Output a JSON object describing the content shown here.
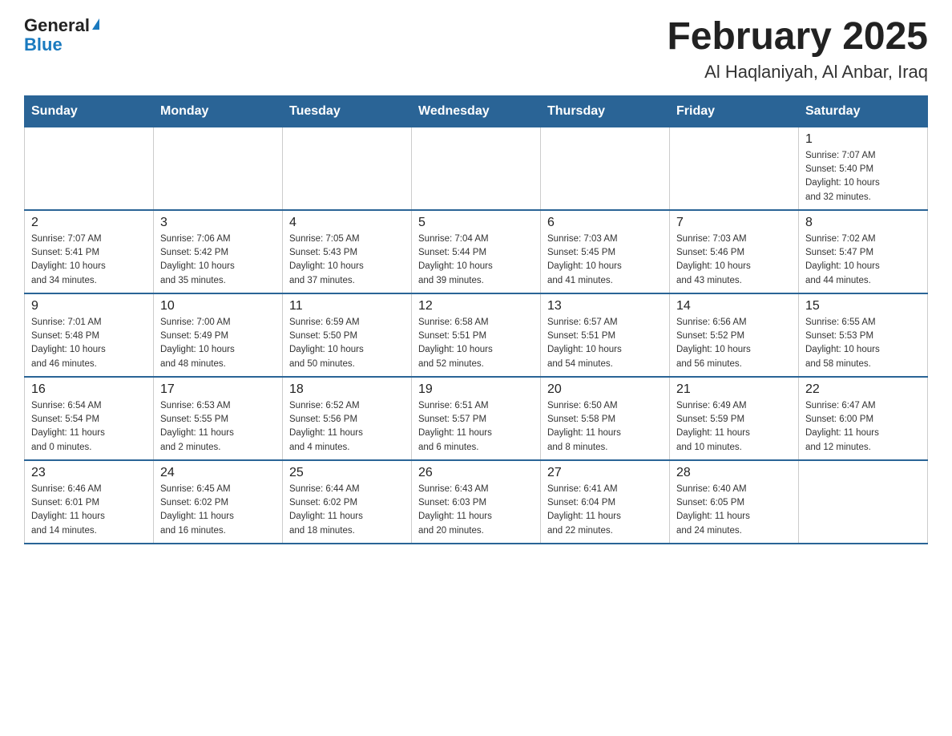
{
  "header": {
    "logo_general": "General",
    "logo_blue": "Blue",
    "month_title": "February 2025",
    "location": "Al Haqlaniyah, Al Anbar, Iraq"
  },
  "days_of_week": [
    "Sunday",
    "Monday",
    "Tuesday",
    "Wednesday",
    "Thursday",
    "Friday",
    "Saturday"
  ],
  "weeks": [
    [
      {
        "day": "",
        "info": ""
      },
      {
        "day": "",
        "info": ""
      },
      {
        "day": "",
        "info": ""
      },
      {
        "day": "",
        "info": ""
      },
      {
        "day": "",
        "info": ""
      },
      {
        "day": "",
        "info": ""
      },
      {
        "day": "1",
        "info": "Sunrise: 7:07 AM\nSunset: 5:40 PM\nDaylight: 10 hours\nand 32 minutes."
      }
    ],
    [
      {
        "day": "2",
        "info": "Sunrise: 7:07 AM\nSunset: 5:41 PM\nDaylight: 10 hours\nand 34 minutes."
      },
      {
        "day": "3",
        "info": "Sunrise: 7:06 AM\nSunset: 5:42 PM\nDaylight: 10 hours\nand 35 minutes."
      },
      {
        "day": "4",
        "info": "Sunrise: 7:05 AM\nSunset: 5:43 PM\nDaylight: 10 hours\nand 37 minutes."
      },
      {
        "day": "5",
        "info": "Sunrise: 7:04 AM\nSunset: 5:44 PM\nDaylight: 10 hours\nand 39 minutes."
      },
      {
        "day": "6",
        "info": "Sunrise: 7:03 AM\nSunset: 5:45 PM\nDaylight: 10 hours\nand 41 minutes."
      },
      {
        "day": "7",
        "info": "Sunrise: 7:03 AM\nSunset: 5:46 PM\nDaylight: 10 hours\nand 43 minutes."
      },
      {
        "day": "8",
        "info": "Sunrise: 7:02 AM\nSunset: 5:47 PM\nDaylight: 10 hours\nand 44 minutes."
      }
    ],
    [
      {
        "day": "9",
        "info": "Sunrise: 7:01 AM\nSunset: 5:48 PM\nDaylight: 10 hours\nand 46 minutes."
      },
      {
        "day": "10",
        "info": "Sunrise: 7:00 AM\nSunset: 5:49 PM\nDaylight: 10 hours\nand 48 minutes."
      },
      {
        "day": "11",
        "info": "Sunrise: 6:59 AM\nSunset: 5:50 PM\nDaylight: 10 hours\nand 50 minutes."
      },
      {
        "day": "12",
        "info": "Sunrise: 6:58 AM\nSunset: 5:51 PM\nDaylight: 10 hours\nand 52 minutes."
      },
      {
        "day": "13",
        "info": "Sunrise: 6:57 AM\nSunset: 5:51 PM\nDaylight: 10 hours\nand 54 minutes."
      },
      {
        "day": "14",
        "info": "Sunrise: 6:56 AM\nSunset: 5:52 PM\nDaylight: 10 hours\nand 56 minutes."
      },
      {
        "day": "15",
        "info": "Sunrise: 6:55 AM\nSunset: 5:53 PM\nDaylight: 10 hours\nand 58 minutes."
      }
    ],
    [
      {
        "day": "16",
        "info": "Sunrise: 6:54 AM\nSunset: 5:54 PM\nDaylight: 11 hours\nand 0 minutes."
      },
      {
        "day": "17",
        "info": "Sunrise: 6:53 AM\nSunset: 5:55 PM\nDaylight: 11 hours\nand 2 minutes."
      },
      {
        "day": "18",
        "info": "Sunrise: 6:52 AM\nSunset: 5:56 PM\nDaylight: 11 hours\nand 4 minutes."
      },
      {
        "day": "19",
        "info": "Sunrise: 6:51 AM\nSunset: 5:57 PM\nDaylight: 11 hours\nand 6 minutes."
      },
      {
        "day": "20",
        "info": "Sunrise: 6:50 AM\nSunset: 5:58 PM\nDaylight: 11 hours\nand 8 minutes."
      },
      {
        "day": "21",
        "info": "Sunrise: 6:49 AM\nSunset: 5:59 PM\nDaylight: 11 hours\nand 10 minutes."
      },
      {
        "day": "22",
        "info": "Sunrise: 6:47 AM\nSunset: 6:00 PM\nDaylight: 11 hours\nand 12 minutes."
      }
    ],
    [
      {
        "day": "23",
        "info": "Sunrise: 6:46 AM\nSunset: 6:01 PM\nDaylight: 11 hours\nand 14 minutes."
      },
      {
        "day": "24",
        "info": "Sunrise: 6:45 AM\nSunset: 6:02 PM\nDaylight: 11 hours\nand 16 minutes."
      },
      {
        "day": "25",
        "info": "Sunrise: 6:44 AM\nSunset: 6:02 PM\nDaylight: 11 hours\nand 18 minutes."
      },
      {
        "day": "26",
        "info": "Sunrise: 6:43 AM\nSunset: 6:03 PM\nDaylight: 11 hours\nand 20 minutes."
      },
      {
        "day": "27",
        "info": "Sunrise: 6:41 AM\nSunset: 6:04 PM\nDaylight: 11 hours\nand 22 minutes."
      },
      {
        "day": "28",
        "info": "Sunrise: 6:40 AM\nSunset: 6:05 PM\nDaylight: 11 hours\nand 24 minutes."
      },
      {
        "day": "",
        "info": ""
      }
    ]
  ]
}
